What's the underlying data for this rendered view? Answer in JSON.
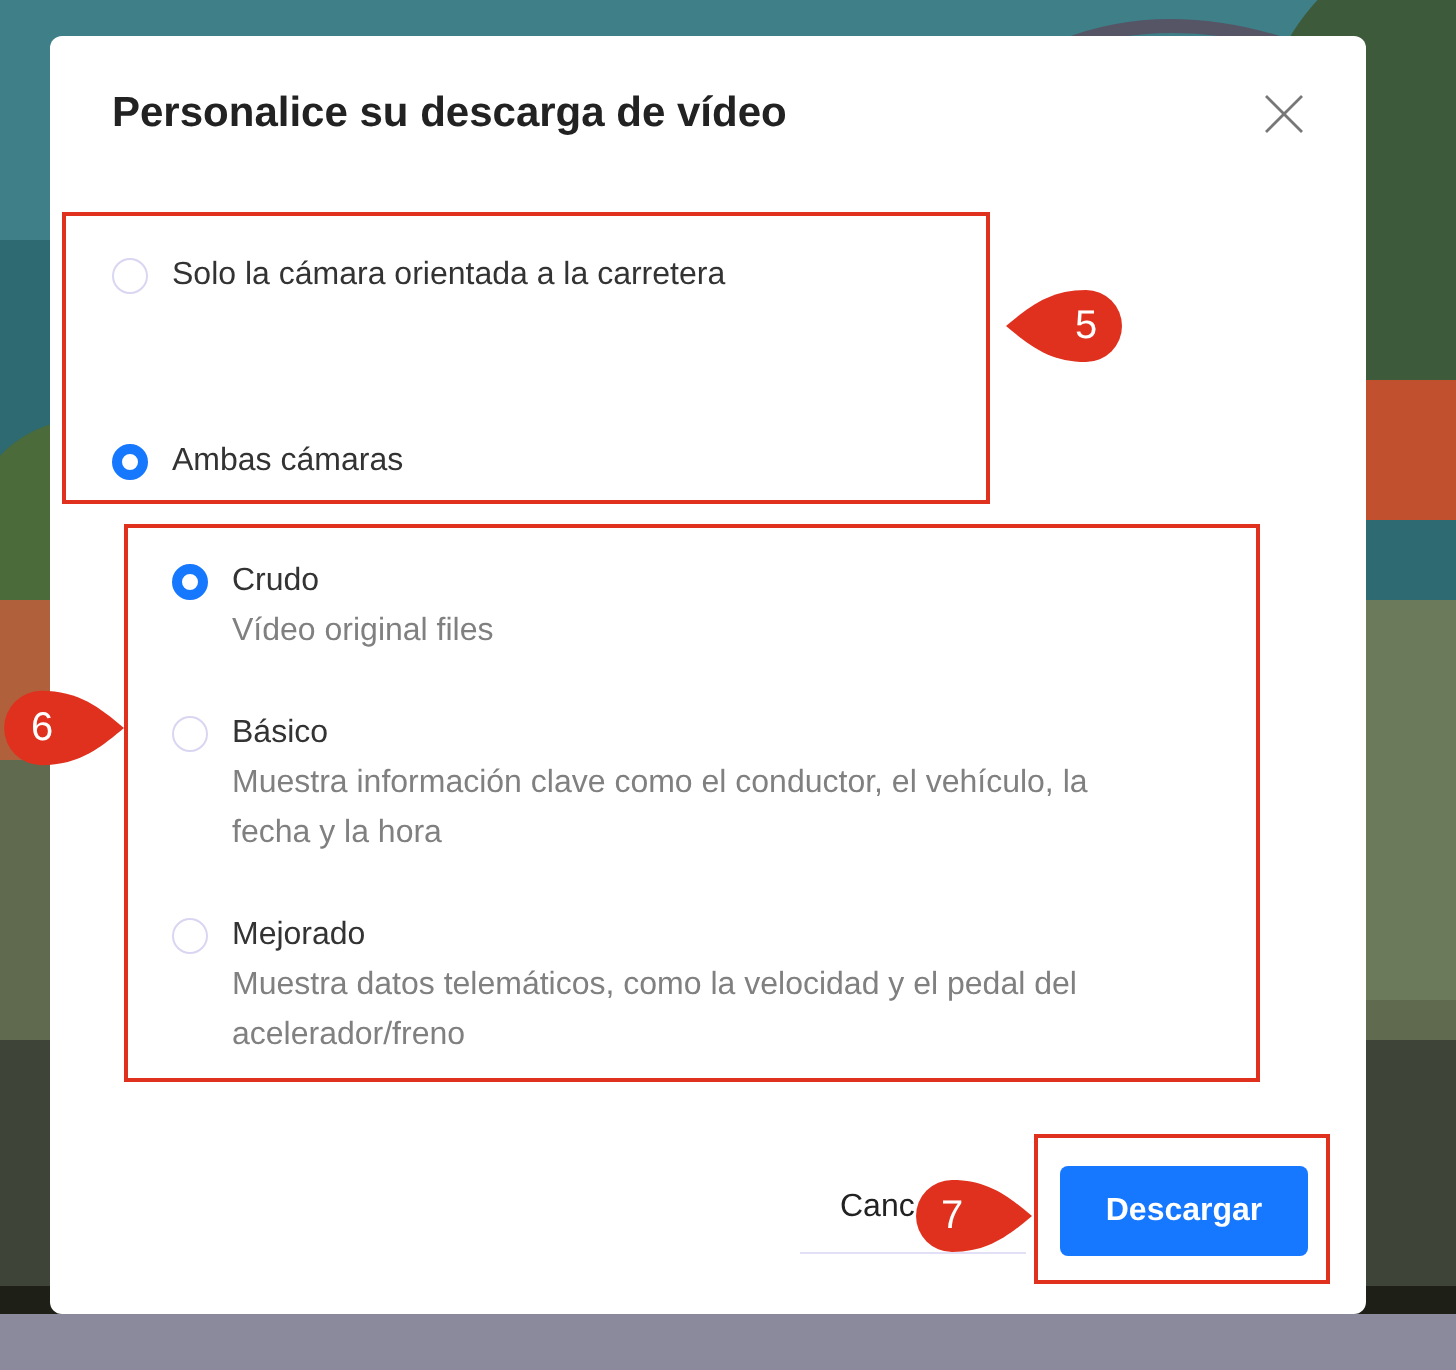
{
  "dialog": {
    "title": "Personalice su descarga de vídeo",
    "camera_section": {
      "callout": "5",
      "options": [
        {
          "label": "Solo la cámara orientada a la carretera",
          "selected": false
        },
        {
          "label": "Ambas cámaras",
          "selected": true
        }
      ]
    },
    "type_section": {
      "callout": "6",
      "options": [
        {
          "label": "Crudo",
          "description": "Vídeo original files",
          "selected": true
        },
        {
          "label": "Básico",
          "description": "Muestra información clave como el conductor, el vehículo, la fecha y la hora",
          "selected": false
        },
        {
          "label": "Mejorado",
          "description": "Muestra datos telemáticos, como la velocidad y el pedal del acelerador/freno",
          "selected": false
        }
      ]
    },
    "footer": {
      "cancel": "Canc",
      "download": "Descargar",
      "callout": "7"
    }
  }
}
